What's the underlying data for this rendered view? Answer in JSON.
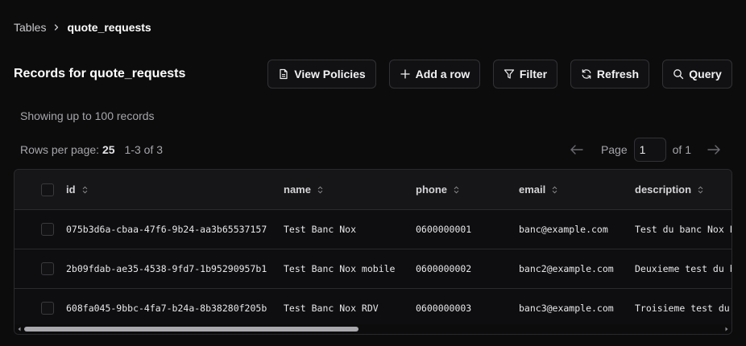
{
  "breadcrumb": {
    "parent": "Tables",
    "current": "quote_requests"
  },
  "page_title": "Records for quote_requests",
  "toolbar": {
    "view_policies": "View Policies",
    "add_row": "Add a row",
    "filter": "Filter",
    "refresh": "Refresh",
    "query": "Query"
  },
  "showing_text": "Showing up to 100 records",
  "rows_per_page": {
    "label": "Rows per page:",
    "value": "25",
    "range": "1-3 of 3"
  },
  "pager": {
    "page_label": "Page",
    "page_value": "1",
    "of_label": "of 1"
  },
  "table": {
    "columns": [
      "id",
      "name",
      "phone",
      "email",
      "description"
    ],
    "rows": [
      {
        "id": "075b3d6a-cbaa-47f6-9b24-aa3b65537157",
        "name": "Test Banc Nox",
        "phone": "0600000001",
        "email": "banc@example.com",
        "description": "Test du banc Nox En"
      },
      {
        "id": "2b09fdab-ae35-4538-9fd7-1b95290957b1",
        "name": "Test Banc Nox mobile",
        "phone": "0600000002",
        "email": "banc2@example.com",
        "description": "Deuxieme test du ba"
      },
      {
        "id": "608fa045-9bbc-4fa7-b24a-8b38280f205b",
        "name": "Test Banc Nox RDV",
        "phone": "0600000003",
        "email": "banc3@example.com",
        "description": "Troisieme test du b"
      }
    ]
  },
  "icons": {
    "chevron": "chevron-right-icon",
    "view_policies": "file-icon",
    "add_row": "plus-icon",
    "filter": "filter-icon",
    "refresh": "refresh-icon",
    "query": "search-icon",
    "sort": "sort-icon",
    "prev": "arrow-left-icon",
    "next": "arrow-right-icon"
  }
}
